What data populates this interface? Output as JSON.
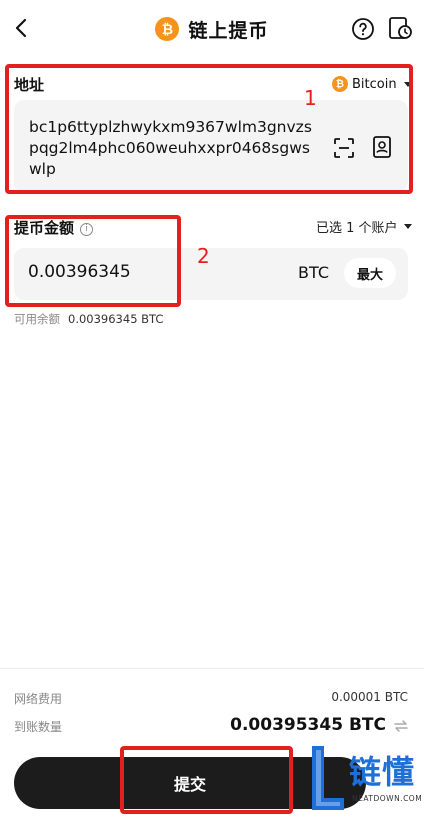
{
  "header": {
    "title": "链上提币",
    "coin_glyph": "₿",
    "icons": [
      "back-arrow-icon",
      "help-circle-icon",
      "history-icon"
    ]
  },
  "address": {
    "label": "地址",
    "network": "Bitcoin",
    "value": "bc1p6ttyplzhwykxm9367wlm3gnvzspqg2lm4phc060weuhxxpr0468sgwswlp",
    "icons": [
      "scan-icon",
      "address-book-icon"
    ]
  },
  "amount": {
    "label": "提币金额",
    "info_glyph": "i",
    "account_select": "已选 1 个账户",
    "value": "0.00396345",
    "unit": "BTC",
    "max_label": "最大",
    "available_label": "可用余额",
    "available_value": "0.00396345 BTC"
  },
  "summary": {
    "fee_label": "网络费用",
    "fee_value": "0.00001 BTC",
    "receive_label": "到账数量",
    "receive_value": "0.00395345 BTC"
  },
  "submit_label": "提交",
  "annotations": {
    "box1_number": "1",
    "box2_number": "2",
    "color": "#e4201f"
  },
  "watermark": {
    "text": "链懂",
    "sub": "NEATDOWN.COM",
    "color": "#1e6fd6"
  }
}
